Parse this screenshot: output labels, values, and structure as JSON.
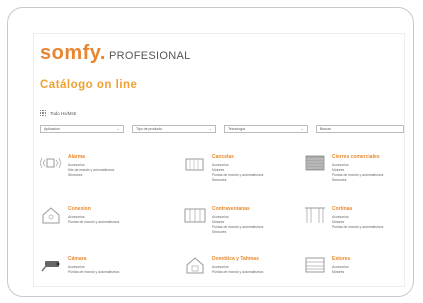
{
  "brand": {
    "name": "somfy.",
    "subtitle": "PROFESIONAL",
    "color": "#e8852f"
  },
  "catalog_title": "Catálogo on line",
  "view_all": {
    "label": "Todo Hs/Mstr"
  },
  "filters": [
    {
      "label": "Aplicación"
    },
    {
      "label": "Tipo de producto"
    },
    {
      "label": "Tecnología"
    },
    {
      "label": "Buscar"
    }
  ],
  "categories": [
    {
      "name": "Alarma",
      "icon": "alarm-siren-icon",
      "subs": [
        "Accesorios",
        "Kits de mando y automatismos",
        "Sensores"
      ]
    },
    {
      "name": "Cancelas",
      "icon": "gate-icon",
      "subs": [
        "Accesorios",
        "Motores",
        "Puntas de mando y automatismos",
        "Sensores"
      ]
    },
    {
      "name": "Cierres comerciales",
      "icon": "shop-shutter-icon",
      "subs": [
        "Accesorios",
        "Motores",
        "Puntas de mando y automatismos",
        "Sensores"
      ]
    },
    {
      "name": "Conexion",
      "icon": "house-connect-icon",
      "subs": [
        "Accesorios",
        "Puntas de mando y automatismos"
      ]
    },
    {
      "name": "Contraventanas",
      "icon": "shutters-icon",
      "subs": [
        "Accesorios",
        "Motores",
        "Puntas de mando y automatismos",
        "Sensores"
      ]
    },
    {
      "name": "Cortinas",
      "icon": "curtain-icon",
      "subs": [
        "Accesorios",
        "Motores",
        "Puntas de mando y automatismos"
      ]
    },
    {
      "name": "Cámara",
      "icon": "camera-icon",
      "subs": [
        "Accesorios",
        "Puntas de mando y automatismos"
      ]
    },
    {
      "name": "Domótica y Tahmas",
      "icon": "home-automation-icon",
      "subs": [
        "Accesorios",
        "Puntas de mando y automatismos"
      ]
    },
    {
      "name": "Estores",
      "icon": "blinds-icon",
      "subs": [
        "Accesorios",
        "Motores"
      ]
    }
  ]
}
